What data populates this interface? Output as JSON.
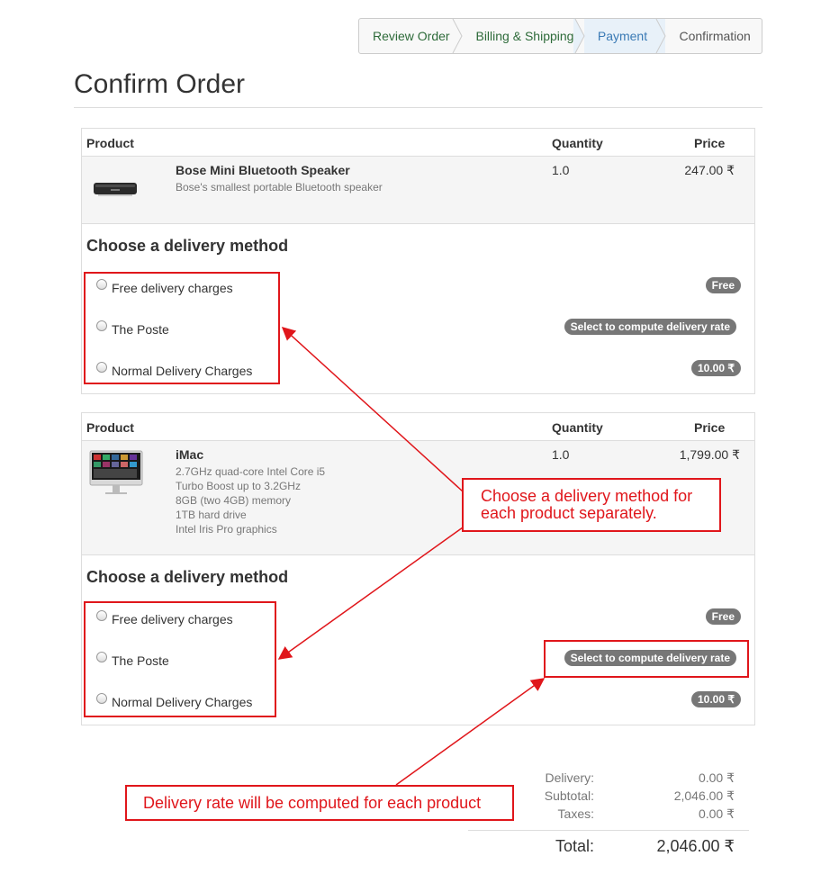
{
  "wizard": {
    "steps": [
      "Review Order",
      "Billing & Shipping",
      "Payment",
      "Confirmation"
    ],
    "active": "Payment"
  },
  "page_title": "Confirm Order",
  "table_headers": {
    "product": "Product",
    "quantity": "Quantity",
    "price": "Price"
  },
  "products": [
    {
      "name": "Bose Mini Bluetooth Speaker",
      "description": [
        "Bose's smallest portable Bluetooth speaker"
      ],
      "quantity": "1.0",
      "price": "247.00 ₹",
      "image_icon": "speaker-image"
    },
    {
      "name": "iMac",
      "description": [
        "2.7GHz quad-core Intel Core i5",
        "Turbo Boost up to 3.2GHz",
        "8GB (two 4GB) memory",
        "1TB hard drive",
        "Intel Iris Pro graphics"
      ],
      "quantity": "1.0",
      "price": "1,799.00 ₹",
      "image_icon": "imac-image"
    }
  ],
  "delivery": {
    "heading": "Choose a delivery method",
    "options": [
      {
        "label": "Free delivery charges",
        "badge": "Free"
      },
      {
        "label": "The Poste",
        "badge": "Select to compute delivery rate"
      },
      {
        "label": "Normal Delivery Charges",
        "badge": "10.00 ₹"
      }
    ]
  },
  "annotations": {
    "callout_method": "Choose a delivery method for each product separately.",
    "callout_method_lines": [
      "Choose a delivery method for",
      "each product separately."
    ],
    "callout_rate": "Delivery rate will be computed for each product",
    "color": "#e0161b"
  },
  "totals": {
    "delivery_label": "Delivery:",
    "delivery_value": "0.00 ₹",
    "subtotal_label": "Subtotal:",
    "subtotal_value": "2,046.00 ₹",
    "taxes_label": "Taxes:",
    "taxes_value": "0.00 ₹",
    "total_label": "Total:",
    "total_value": "2,046.00 ₹"
  },
  "colors": {
    "badge": "#777777",
    "active_step_bg": "#e8f1f9",
    "step_text": "#2e6b3a"
  }
}
